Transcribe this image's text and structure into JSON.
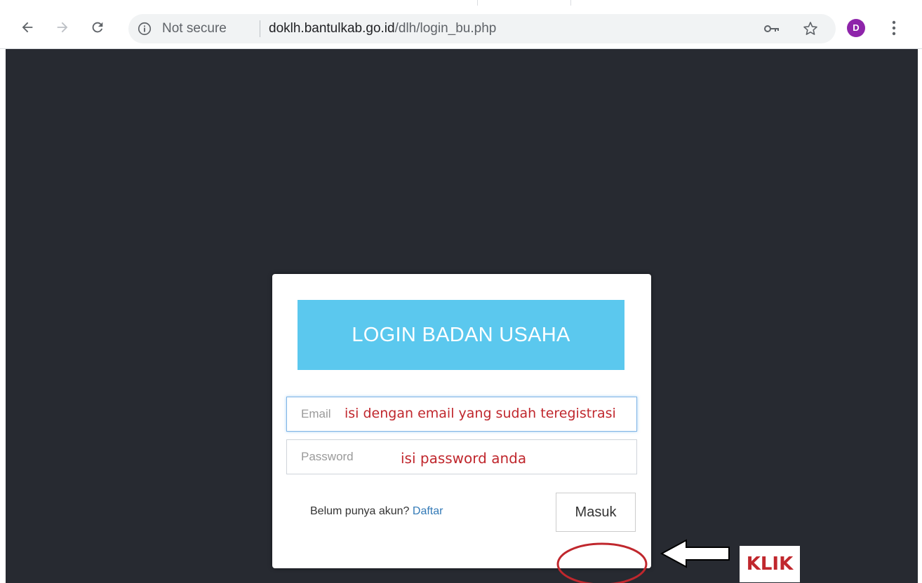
{
  "browser": {
    "back_icon": "arrow-left-icon",
    "forward_icon": "arrow-right-icon",
    "reload_icon": "reload-icon",
    "security_label": "Not secure",
    "url_host": "doklh.bantulkab.go.id",
    "url_path": "/dlh/login_bu.php",
    "avatar_letter": "D"
  },
  "login": {
    "title": "LOGIN BADAN USAHA",
    "email_placeholder": "Email",
    "email_annotation": "isi dengan email yang sudah teregistrasi",
    "password_placeholder": "Password",
    "password_annotation": "isi password anda",
    "signup_prompt": "Belum punya akun?",
    "signup_link": "Daftar",
    "submit_label": "Masuk"
  },
  "annotation": {
    "callout_label": "KLIK",
    "accent_color": "#c0272d"
  },
  "colors": {
    "page_background": "#272a31",
    "header_background": "#5bc8ee"
  }
}
